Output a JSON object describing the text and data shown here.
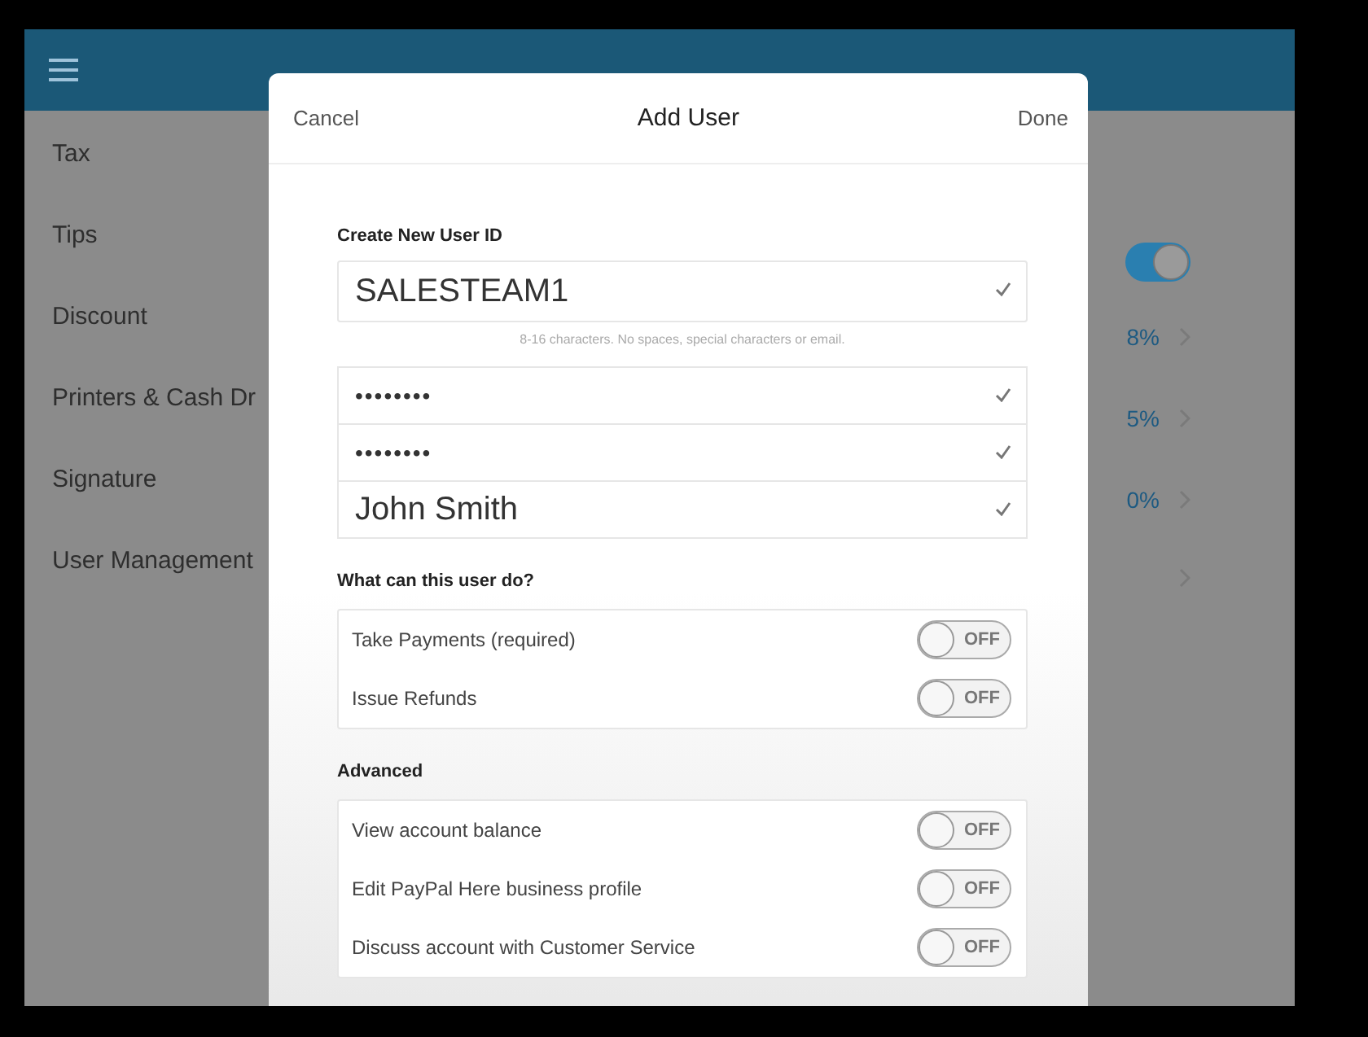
{
  "settings": [
    {
      "label": "Tax",
      "kind": "plain"
    },
    {
      "label": "Tips",
      "kind": "toggle",
      "on": true
    },
    {
      "label": "Discount",
      "kind": "value",
      "value": "8%"
    },
    {
      "label": "Printers & Cash Dr",
      "kind": "value",
      "value": "5%"
    },
    {
      "label": "Signature",
      "kind": "value",
      "value": "0%"
    },
    {
      "label": "User Management",
      "kind": "link"
    }
  ],
  "dialog": {
    "cancel": "Cancel",
    "title": "Add User",
    "done": "Done",
    "id_label": "Create New User ID",
    "id_field": {
      "kind": "text",
      "value": "SALESTEAM1",
      "valid": true
    },
    "hint": "8-16 characters. No spaces, special characters or email.",
    "fields": [
      {
        "kind": "password",
        "value": "••••••••",
        "valid": true
      },
      {
        "kind": "password",
        "value": "••••••••",
        "valid": true
      },
      {
        "kind": "text",
        "value": "John Smith",
        "valid": true
      }
    ],
    "sections": [
      {
        "title": "What can this user do?",
        "permissions": [
          {
            "label": "Take Payments (required)",
            "on": false,
            "state_text": "OFF"
          },
          {
            "label": "Issue Refunds",
            "on": false,
            "state_text": "OFF"
          }
        ]
      },
      {
        "title": "Advanced",
        "permissions": [
          {
            "label": "View account balance",
            "on": false,
            "state_text": "OFF"
          },
          {
            "label": "Edit PayPal Here business profile",
            "on": false,
            "state_text": "OFF"
          },
          {
            "label": "Discuss account with Customer Service",
            "on": false,
            "state_text": "OFF"
          }
        ]
      }
    ]
  }
}
